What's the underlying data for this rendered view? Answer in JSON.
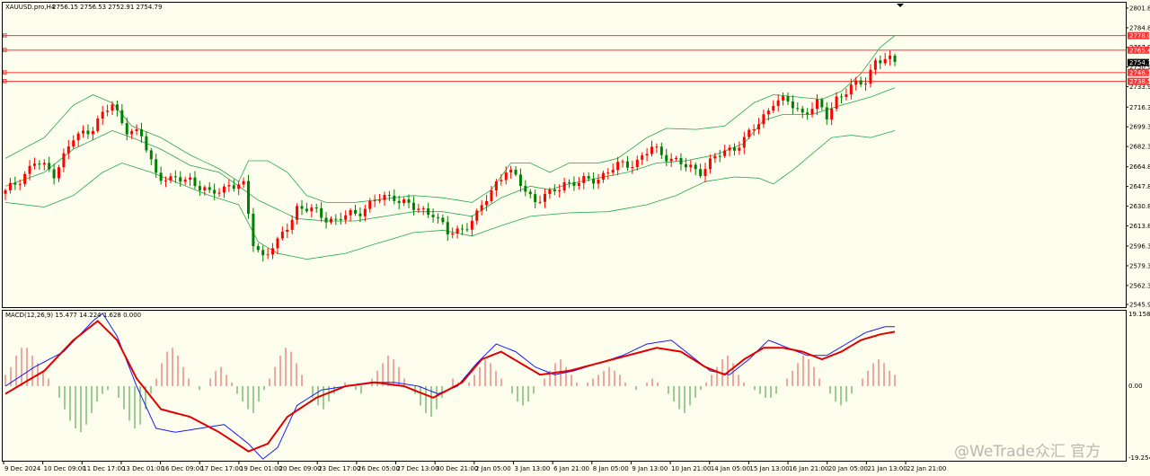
{
  "header": {
    "symbol_info": "XAUUSD.pro,H4",
    "ohlc": "2756.15 2756.53 2752.91 2754.79"
  },
  "macd": {
    "label": "MACD(12,26,9) 15.477 14.224 1.628 0.000",
    "axis_ticks": [
      "19.158",
      "0.00",
      "-19.254"
    ]
  },
  "watermark": "@WeTrade众汇 官方",
  "colors": {
    "background": "#fefeef",
    "bull_candle": "#ff0000",
    "bear_candle": "#008000",
    "bollinger": "#22a84a",
    "level_line": "#ff3333",
    "macd_line": "#1a1aff",
    "signal_line": "#e00000",
    "hist_up": "#e05050",
    "hist_down": "#3a9a3a"
  },
  "chart_data": [
    {
      "type": "candlestick",
      "y_ticks": [
        "2801.80",
        "2784.80",
        "2767.90",
        "2750.90",
        "2733.90",
        "2716.30",
        "2699.30",
        "2682.30",
        "2664.80",
        "2647.80",
        "2630.80",
        "2613.80",
        "2596.30",
        "2579.30",
        "2562.30",
        "2545.90"
      ],
      "ylim": [
        2545.9,
        2801.8
      ],
      "x_labels": [
        "9 Dec 2024",
        "10 Dec 09:00",
        "11 Dec 17:00",
        "13 Dec 01:00",
        "16 Dec 09:00",
        "17 Dec 17:00",
        "19 Dec 01:00",
        "20 Dec 09:00",
        "23 Dec 17:00",
        "26 Dec 05:00",
        "27 Dec 13:00",
        "30 Dec 21:00",
        "2 Jan 05:00",
        "3 Jan 13:00",
        "6 Jan 21:00",
        "8 Jan 05:00",
        "9 Jan 13:00",
        "10 Jan 21:00",
        "14 Jan 05:00",
        "15 Jan 13:00",
        "16 Jan 21:00",
        "20 Jan 05:00",
        "21 Jan 13:00",
        "22 Jan 21:00"
      ],
      "price_levels": [
        {
          "label": "2778.01",
          "value": 2778.01
        },
        {
          "label": "2765.47",
          "value": 2765.47
        },
        {
          "label": "2754.79",
          "value": 2754.79,
          "current": true
        },
        {
          "label": "2746.11",
          "value": 2746.11
        },
        {
          "label": "2738.52",
          "value": 2738.52
        }
      ],
      "close_path": [
        [
          0,
          2642
        ],
        [
          6,
          2668
        ],
        [
          10,
          2660
        ],
        [
          14,
          2688
        ],
        [
          18,
          2700
        ],
        [
          22,
          2718
        ],
        [
          25,
          2698
        ],
        [
          28,
          2690
        ],
        [
          31,
          2660
        ],
        [
          34,
          2652
        ],
        [
          38,
          2655
        ],
        [
          42,
          2640
        ],
        [
          46,
          2650
        ],
        [
          49,
          2647
        ],
        [
          51,
          2600
        ],
        [
          53,
          2588
        ],
        [
          56,
          2598
        ],
        [
          60,
          2630
        ],
        [
          64,
          2625
        ],
        [
          68,
          2618
        ],
        [
          72,
          2625
        ],
        [
          76,
          2635
        ],
        [
          80,
          2640
        ],
        [
          84,
          2628
        ],
        [
          88,
          2626
        ],
        [
          91,
          2606
        ],
        [
          94,
          2612
        ],
        [
          97,
          2622
        ],
        [
          101,
          2652
        ],
        [
          103,
          2662
        ],
        [
          106,
          2650
        ],
        [
          109,
          2636
        ],
        [
          112,
          2640
        ],
        [
          115,
          2652
        ],
        [
          118,
          2650
        ],
        [
          122,
          2656
        ],
        [
          126,
          2665
        ],
        [
          130,
          2670
        ],
        [
          133,
          2680
        ],
        [
          136,
          2675
        ],
        [
          140,
          2664
        ],
        [
          143,
          2662
        ],
        [
          146,
          2672
        ],
        [
          149,
          2680
        ],
        [
          152,
          2688
        ],
        [
          155,
          2702
        ],
        [
          158,
          2722
        ],
        [
          161,
          2720
        ],
        [
          164,
          2712
        ],
        [
          167,
          2718
        ],
        [
          169,
          2708
        ],
        [
          171,
          2725
        ],
        [
          174,
          2732
        ],
        [
          177,
          2740
        ],
        [
          179,
          2757
        ],
        [
          181,
          2756
        ],
        [
          183,
          2755
        ]
      ],
      "bollinger": {
        "upper": [
          [
            0,
            2672
          ],
          [
            8,
            2690
          ],
          [
            14,
            2718
          ],
          [
            18,
            2727
          ],
          [
            22,
            2720
          ],
          [
            26,
            2700
          ],
          [
            32,
            2690
          ],
          [
            38,
            2675
          ],
          [
            44,
            2663
          ],
          [
            48,
            2652
          ],
          [
            50,
            2670
          ],
          [
            54,
            2670
          ],
          [
            58,
            2660
          ],
          [
            62,
            2640
          ],
          [
            66,
            2634
          ],
          [
            72,
            2634
          ],
          [
            78,
            2637
          ],
          [
            84,
            2640
          ],
          [
            90,
            2638
          ],
          [
            96,
            2634
          ],
          [
            100,
            2645
          ],
          [
            104,
            2668
          ],
          [
            108,
            2668
          ],
          [
            112,
            2660
          ],
          [
            116,
            2668
          ],
          [
            122,
            2668
          ],
          [
            126,
            2672
          ],
          [
            132,
            2690
          ],
          [
            136,
            2698
          ],
          [
            142,
            2697
          ],
          [
            148,
            2700
          ],
          [
            154,
            2720
          ],
          [
            158,
            2727
          ],
          [
            163,
            2725
          ],
          [
            168,
            2723
          ],
          [
            172,
            2730
          ],
          [
            176,
            2745
          ],
          [
            180,
            2768
          ],
          [
            183,
            2778
          ]
        ],
        "middle": [
          [
            0,
            2648
          ],
          [
            8,
            2660
          ],
          [
            14,
            2680
          ],
          [
            18,
            2688
          ],
          [
            22,
            2696
          ],
          [
            26,
            2690
          ],
          [
            32,
            2680
          ],
          [
            38,
            2666
          ],
          [
            44,
            2660
          ],
          [
            48,
            2648
          ],
          [
            52,
            2636
          ],
          [
            56,
            2628
          ],
          [
            60,
            2620
          ],
          [
            66,
            2618
          ],
          [
            72,
            2618
          ],
          [
            78,
            2622
          ],
          [
            84,
            2626
          ],
          [
            90,
            2626
          ],
          [
            96,
            2622
          ],
          [
            102,
            2638
          ],
          [
            108,
            2648
          ],
          [
            112,
            2645
          ],
          [
            116,
            2650
          ],
          [
            122,
            2655
          ],
          [
            128,
            2660
          ],
          [
            134,
            2668
          ],
          [
            140,
            2670
          ],
          [
            146,
            2675
          ],
          [
            152,
            2685
          ],
          [
            156,
            2705
          ],
          [
            160,
            2710
          ],
          [
            166,
            2710
          ],
          [
            172,
            2718
          ],
          [
            178,
            2725
          ],
          [
            183,
            2733
          ]
        ],
        "lower": [
          [
            0,
            2634
          ],
          [
            8,
            2630
          ],
          [
            14,
            2640
          ],
          [
            20,
            2660
          ],
          [
            24,
            2668
          ],
          [
            30,
            2660
          ],
          [
            36,
            2650
          ],
          [
            42,
            2640
          ],
          [
            48,
            2632
          ],
          [
            52,
            2600
          ],
          [
            56,
            2590
          ],
          [
            62,
            2585
          ],
          [
            70,
            2590
          ],
          [
            76,
            2598
          ],
          [
            84,
            2608
          ],
          [
            90,
            2610
          ],
          [
            96,
            2605
          ],
          [
            102,
            2614
          ],
          [
            108,
            2622
          ],
          [
            116,
            2625
          ],
          [
            124,
            2626
          ],
          [
            132,
            2632
          ],
          [
            138,
            2640
          ],
          [
            144,
            2652
          ],
          [
            150,
            2656
          ],
          [
            155,
            2655
          ],
          [
            158,
            2650
          ],
          [
            162,
            2662
          ],
          [
            166,
            2676
          ],
          [
            170,
            2690
          ],
          [
            174,
            2692
          ],
          [
            178,
            2690
          ],
          [
            183,
            2696
          ]
        ]
      }
    },
    {
      "type": "line",
      "title": "MACD(12,26,9) 15.477 14.224 1.628 0.000",
      "ylim": [
        -19.254,
        19.158
      ],
      "series": [
        {
          "name": "MACD",
          "values": [
            [
              0,
              0
            ],
            [
              6,
              5
            ],
            [
              12,
              9
            ],
            [
              18,
              17
            ],
            [
              20,
              19
            ],
            [
              23,
              13
            ],
            [
              27,
              0
            ],
            [
              31,
              -11
            ],
            [
              35,
              -12
            ],
            [
              40,
              -11
            ],
            [
              45,
              -10
            ],
            [
              50,
              -15
            ],
            [
              53,
              -19
            ],
            [
              56,
              -16
            ],
            [
              60,
              -5
            ],
            [
              65,
              -1
            ],
            [
              70,
              0
            ],
            [
              75,
              1
            ],
            [
              80,
              1
            ],
            [
              85,
              0
            ],
            [
              89,
              -2
            ],
            [
              93,
              0
            ],
            [
              97,
              6
            ],
            [
              101,
              11
            ],
            [
              105,
              9
            ],
            [
              109,
              5
            ],
            [
              113,
              3
            ],
            [
              117,
              4
            ],
            [
              122,
              6
            ],
            [
              127,
              8
            ],
            [
              132,
              11
            ],
            [
              137,
              12
            ],
            [
              141,
              8
            ],
            [
              145,
              4
            ],
            [
              149,
              3
            ],
            [
              153,
              7
            ],
            [
              157,
              12
            ],
            [
              161,
              10
            ],
            [
              165,
              8
            ],
            [
              169,
              8
            ],
            [
              173,
              11
            ],
            [
              177,
              14
            ],
            [
              181,
              15.5
            ],
            [
              183,
              15.5
            ]
          ]
        },
        {
          "name": "Signal",
          "values": [
            [
              0,
              -2
            ],
            [
              8,
              4
            ],
            [
              14,
              12
            ],
            [
              19,
              17
            ],
            [
              23,
              12
            ],
            [
              27,
              2
            ],
            [
              32,
              -6
            ],
            [
              38,
              -8
            ],
            [
              44,
              -12
            ],
            [
              50,
              -17
            ],
            [
              54,
              -15
            ],
            [
              58,
              -8
            ],
            [
              64,
              -3
            ],
            [
              70,
              0
            ],
            [
              76,
              1
            ],
            [
              82,
              0
            ],
            [
              88,
              -3
            ],
            [
              94,
              1
            ],
            [
              98,
              7
            ],
            [
              102,
              9
            ],
            [
              106,
              6
            ],
            [
              110,
              3
            ],
            [
              116,
              4
            ],
            [
              122,
              6
            ],
            [
              128,
              8
            ],
            [
              134,
              10
            ],
            [
              139,
              9
            ],
            [
              144,
              5
            ],
            [
              148,
              3
            ],
            [
              152,
              7
            ],
            [
              156,
              10
            ],
            [
              160,
              10
            ],
            [
              164,
              9
            ],
            [
              168,
              7
            ],
            [
              172,
              9
            ],
            [
              176,
              12
            ],
            [
              180,
              13.5
            ],
            [
              183,
              14.2
            ]
          ]
        }
      ],
      "histogram": [
        3,
        5,
        8,
        10,
        10,
        8,
        6,
        4,
        2,
        0,
        -3,
        -6,
        -9,
        -11,
        -12,
        -10,
        -7,
        -4,
        -2,
        -1,
        0,
        -3,
        -6,
        -9,
        -11,
        -10,
        -6,
        -2,
        2,
        6,
        9,
        10,
        8,
        5,
        2,
        0,
        -1,
        0,
        2,
        4,
        5,
        3,
        1,
        -2,
        -4,
        -6,
        -7,
        -4,
        -1,
        2,
        5,
        8,
        10,
        9,
        6,
        3,
        0,
        -3,
        -5,
        -6,
        -4,
        -2,
        0,
        1,
        0,
        -1,
        -2,
        0,
        2,
        4,
        6,
        8,
        7,
        5,
        2,
        0,
        -2,
        -5,
        -7,
        -8,
        -6,
        -3,
        0,
        2,
        1,
        0,
        1,
        3,
        5,
        7,
        6,
        4,
        2,
        0,
        -2,
        -4,
        -5,
        -4,
        -2,
        0,
        2,
        4,
        6,
        7,
        5,
        3,
        1,
        0,
        1,
        2,
        3,
        4,
        5,
        4,
        3,
        1,
        0,
        -1,
        0,
        1,
        2,
        1,
        0,
        -2,
        -4,
        -6,
        -7,
        -5,
        -3,
        -1,
        1,
        3,
        5,
        7,
        8,
        6,
        3,
        1,
        0,
        -1,
        -2,
        -3,
        -3,
        -2,
        0,
        2,
        4,
        6,
        8,
        7,
        5,
        2,
        0,
        -2,
        -4,
        -5,
        -4,
        -2,
        0,
        2,
        4,
        6,
        7,
        6,
        4,
        3
      ]
    }
  ]
}
